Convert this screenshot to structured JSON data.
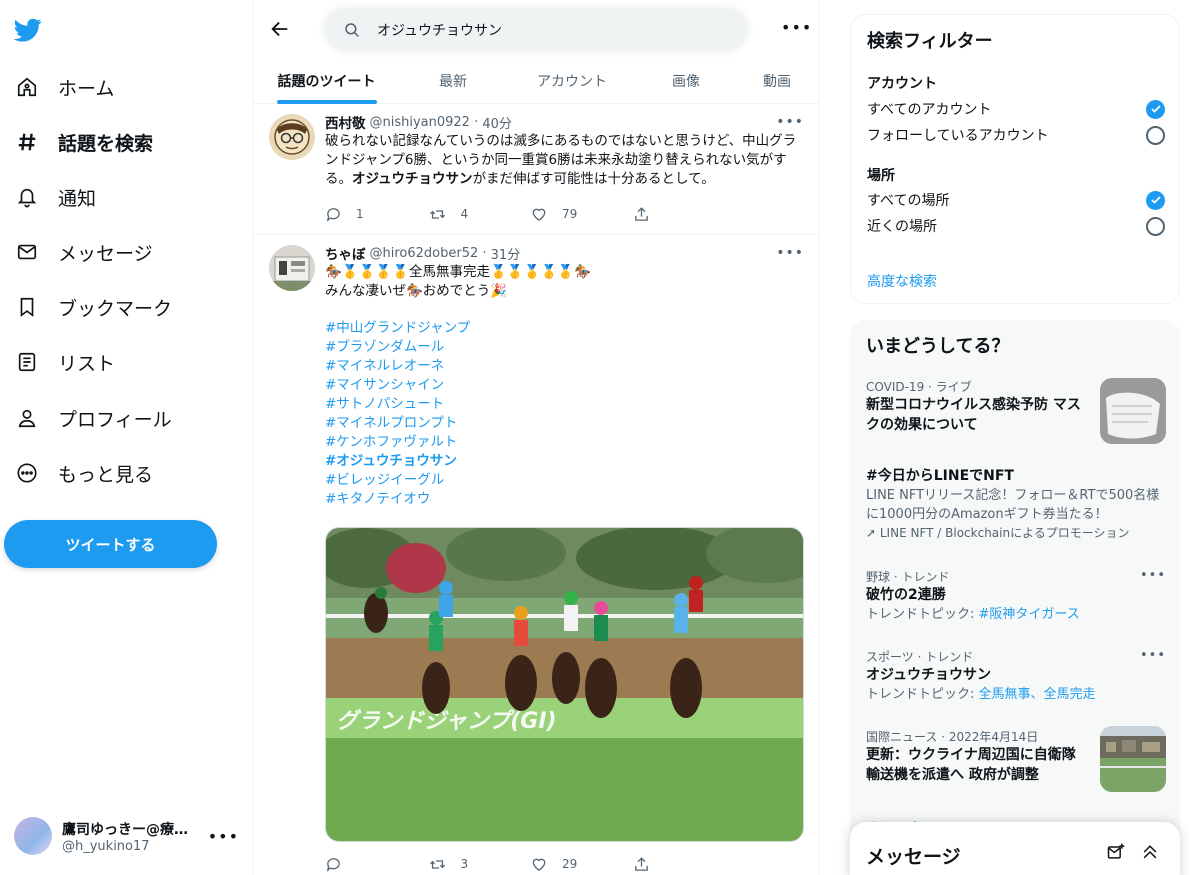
{
  "nav": {
    "items": [
      {
        "label": "ホーム",
        "icon": "home-icon"
      },
      {
        "label": "話題を検索",
        "icon": "hashtag-icon"
      },
      {
        "label": "通知",
        "icon": "bell-icon"
      },
      {
        "label": "メッセージ",
        "icon": "mail-icon"
      },
      {
        "label": "ブックマーク",
        "icon": "bookmark-icon"
      },
      {
        "label": "リスト",
        "icon": "list-icon"
      },
      {
        "label": "プロフィール",
        "icon": "person-icon"
      },
      {
        "label": "もっと見る",
        "icon": "more-circle-icon"
      }
    ],
    "tweet_button": "ツイートする",
    "account": {
      "name": "鷹司ゆっきー@療…",
      "handle": "@h_yukino17"
    }
  },
  "search": {
    "query": "オジュウチョウサン"
  },
  "tabs": [
    "話題のツイート",
    "最新",
    "アカウント",
    "画像",
    "動画"
  ],
  "tweets": [
    {
      "name": "西村敬",
      "handle": "@nishiyan0922",
      "time": "40分",
      "text_a": "破られない記録なんていうのは滅多にあるものではないと思うけど、中山グランドジャンプ6勝、というか同一重賞6勝は未来永劫塗り替えられない気がする。",
      "text_bold": "オジュウチョウサン",
      "text_b": "がまだ伸ばす可能性は十分あるとして。",
      "replies": "1",
      "retweets": "4",
      "likes": "79"
    },
    {
      "name": "ちゃぼ",
      "handle": "@hiro62dober52",
      "time": "31分",
      "line1": "🏇🥇🥇🥇🥇全馬無事完走🥇🥇🥇🥇🥇🏇",
      "line2": "みんな凄いぜ🏇おめでとう🎉",
      "hashtags": [
        "#中山グランドジャンプ",
        "#ブラゾンダムール",
        "#マイネルレオーネ",
        "#マイサンシャイン",
        "#サトノパシュート",
        "#マイネルプロンプト",
        "#ケンホファヴァルト",
        "#オジュウチョウサン",
        "#ビレッジイーグル",
        "#キタノテイオウ"
      ],
      "photo_banner": "グランドジャンプ(GⅠ)",
      "replies": "",
      "retweets": "3",
      "likes": "29"
    }
  ],
  "filter": {
    "title": "検索フィルター",
    "account_label": "アカウント",
    "account_options": [
      "すべてのアカウント",
      "フォローしているアカウント"
    ],
    "place_label": "場所",
    "place_options": [
      "すべての場所",
      "近くの場所"
    ],
    "advanced": "高度な検索"
  },
  "trends": {
    "title": "いまどうしてる？",
    "items": [
      {
        "meta": "COVID-19 · ライブ",
        "title": "新型コロナウイルス感染予防 マスクの効果について"
      },
      {
        "meta": "",
        "title": "#今日からLINEでNFT",
        "desc": "LINE NFTリリース記念！フォロー＆RTで500名様に1000円分のAmazonギフト券当たる！",
        "promo": "LINE NFT / Blockchainによるプロモーション"
      },
      {
        "meta": "野球 · トレンド",
        "title": "破竹の2連勝",
        "sub_prefix": "トレンドトピック: ",
        "sub_link": "#阪神タイガース"
      },
      {
        "meta": "スポーツ · トレンド",
        "title": "オジュウチョウサン",
        "sub_prefix": "トレンドトピック: ",
        "sub_link": "全馬無事、全馬完走"
      },
      {
        "meta": "国際ニュース · 2022年4月14日",
        "title": "更新：ウクライナ周辺国に自衛隊輸送機を派遣へ 政府が調整"
      }
    ],
    "show_more": "さらに表示"
  },
  "messages": {
    "title": "メッセージ"
  },
  "colors": {
    "accent": "#1d9bf0",
    "text": "#0f1419",
    "muted": "#536471"
  }
}
